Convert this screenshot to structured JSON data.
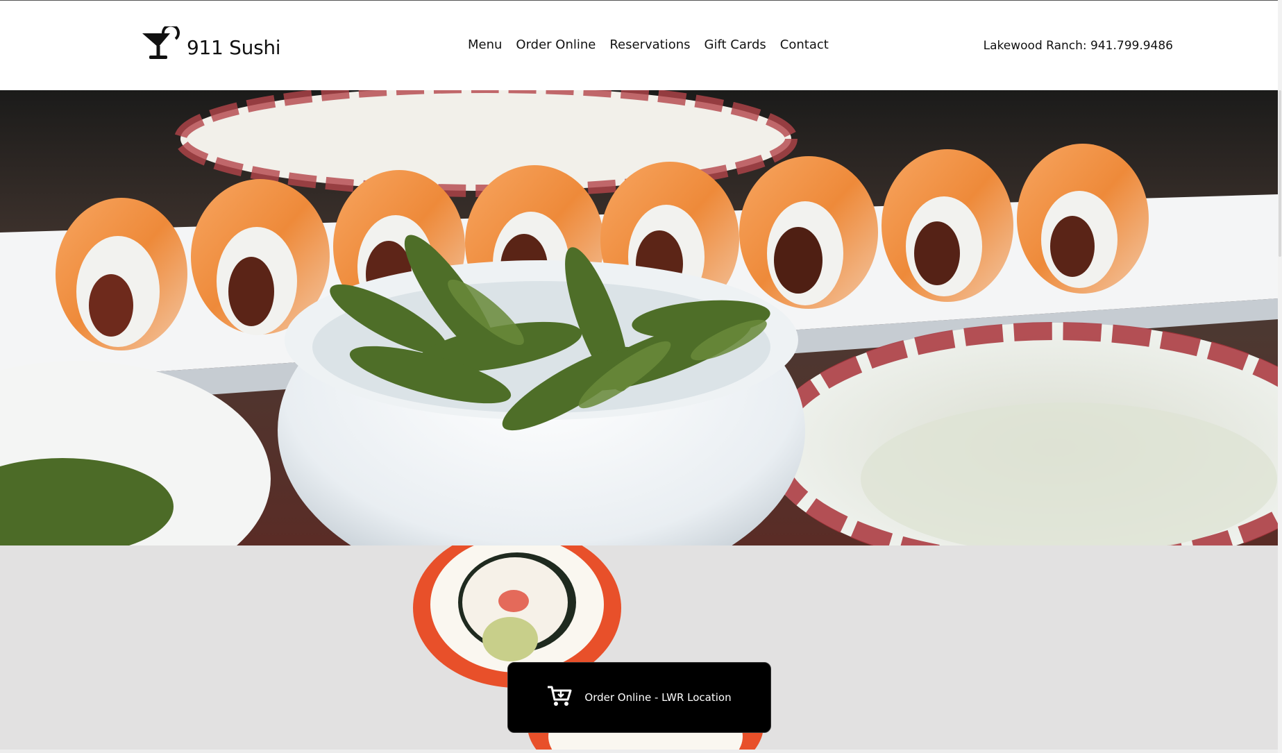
{
  "brand": {
    "name": "911 Sushi",
    "logo_icon": "cocktail-glass-icon"
  },
  "nav": {
    "items": [
      {
        "label": "Menu"
      },
      {
        "label": "Order Online"
      },
      {
        "label": "Reservations"
      },
      {
        "label": "Gift Cards"
      },
      {
        "label": "Contact"
      }
    ]
  },
  "header": {
    "phone_text": "Lakewood Ranch: 941.799.9486"
  },
  "order_cta": {
    "label": "Order Online - LWR Location",
    "icon": "cart-download-icon"
  },
  "colors": {
    "button_bg": "#000000",
    "section_bg": "#e2e1e1",
    "salmon": "#f08a3c",
    "edamame": "#4e6e28",
    "plate_trim": "#a8323a"
  }
}
